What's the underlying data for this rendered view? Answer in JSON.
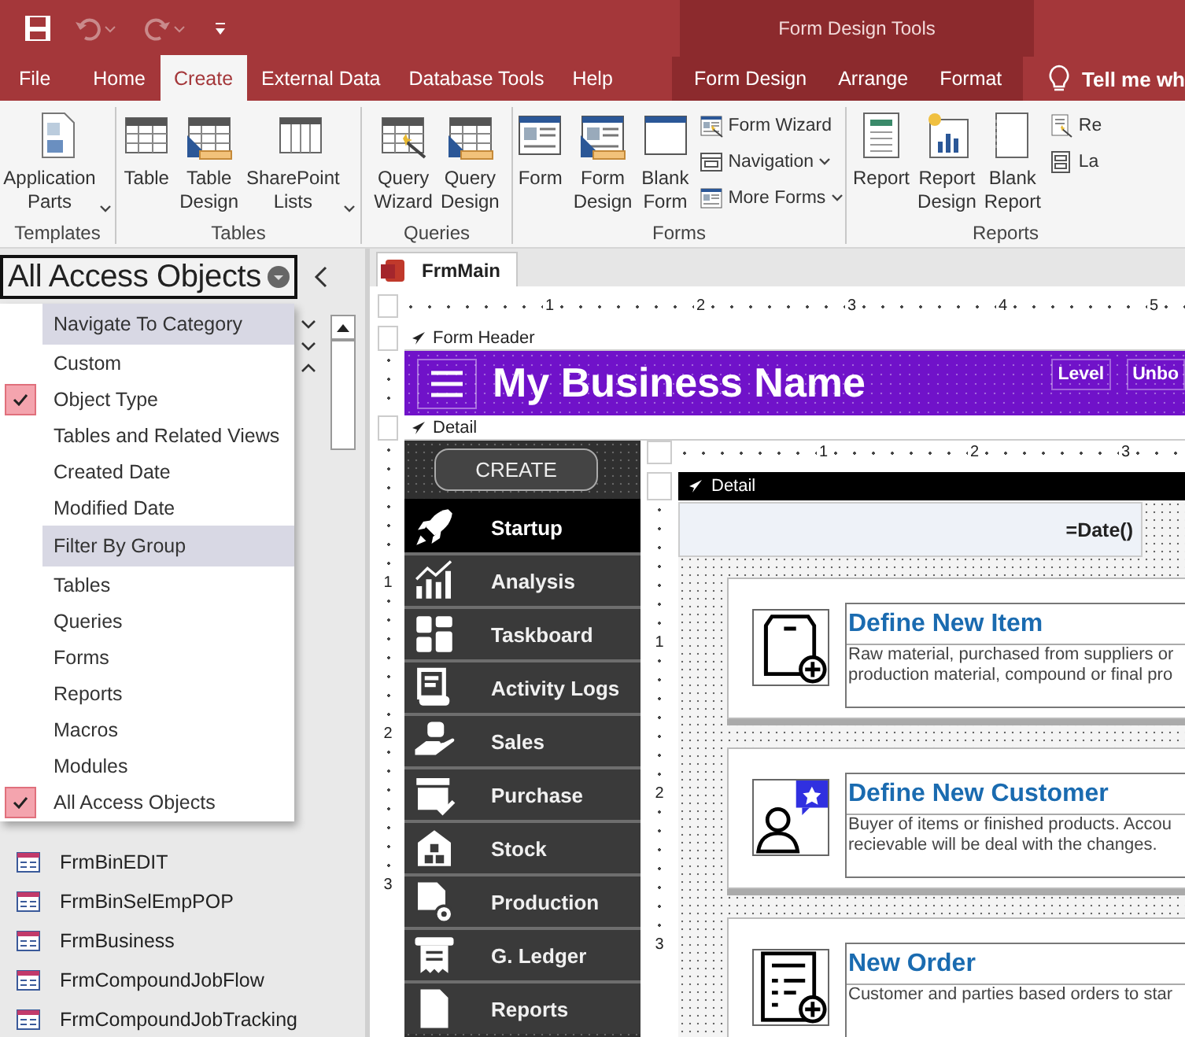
{
  "title_bar": {
    "contextual_title": "Form Design Tools"
  },
  "ribbon_tabs": [
    {
      "label": "File",
      "selected": false,
      "contextual": false
    },
    {
      "label": "Home",
      "selected": false,
      "contextual": false
    },
    {
      "label": "Create",
      "selected": true,
      "contextual": false
    },
    {
      "label": "External Data",
      "selected": false,
      "contextual": false
    },
    {
      "label": "Database Tools",
      "selected": false,
      "contextual": false
    },
    {
      "label": "Help",
      "selected": false,
      "contextual": false
    },
    {
      "label": "Form Design",
      "selected": false,
      "contextual": true
    },
    {
      "label": "Arrange",
      "selected": false,
      "contextual": true
    },
    {
      "label": "Format",
      "selected": false,
      "contextual": true
    }
  ],
  "tell_me": "Tell me wh",
  "ribbon_groups": [
    {
      "title": "Templates",
      "buttons": [
        {
          "kind": "large",
          "label": "Application Parts",
          "dropdown": true
        }
      ]
    },
    {
      "title": "Tables",
      "buttons": [
        {
          "kind": "large",
          "label": "Table",
          "dropdown": false
        },
        {
          "kind": "large",
          "label": "Table Design",
          "dropdown": false
        },
        {
          "kind": "large",
          "label": "SharePoint Lists",
          "dropdown": true
        }
      ]
    },
    {
      "title": "Queries",
      "buttons": [
        {
          "kind": "large",
          "label": "Query Wizard",
          "dropdown": false
        },
        {
          "kind": "large",
          "label": "Query Design",
          "dropdown": false
        }
      ]
    },
    {
      "title": "Forms",
      "buttons": [
        {
          "kind": "large",
          "label": "Form",
          "dropdown": false
        },
        {
          "kind": "large",
          "label": "Form Design",
          "dropdown": false
        },
        {
          "kind": "large",
          "label": "Blank Form",
          "dropdown": false
        },
        {
          "kind": "small",
          "label": "Form Wizard",
          "dropdown": false
        },
        {
          "kind": "small",
          "label": "Navigation",
          "dropdown": true
        },
        {
          "kind": "small",
          "label": "More Forms",
          "dropdown": true
        }
      ]
    },
    {
      "title": "Reports",
      "buttons": [
        {
          "kind": "large",
          "label": "Report",
          "dropdown": false
        },
        {
          "kind": "large",
          "label": "Report Design",
          "dropdown": false
        },
        {
          "kind": "large",
          "label": "Blank Report",
          "dropdown": false
        },
        {
          "kind": "small",
          "label": "Re",
          "dropdown": false
        },
        {
          "kind": "small",
          "label": "La",
          "dropdown": false
        }
      ]
    }
  ],
  "nav_pane": {
    "title": "All Access Objects",
    "menu": [
      {
        "kind": "heading",
        "label": "Navigate To Category"
      },
      {
        "kind": "option",
        "label": "Custom",
        "checked": false
      },
      {
        "kind": "option",
        "label": "Object Type",
        "checked": true
      },
      {
        "kind": "option",
        "label": "Tables and Related Views",
        "checked": false
      },
      {
        "kind": "option",
        "label": "Created Date",
        "checked": false
      },
      {
        "kind": "option",
        "label": "Modified Date",
        "checked": false
      },
      {
        "kind": "heading",
        "label": "Filter By Group"
      },
      {
        "kind": "option",
        "label": "Tables",
        "checked": false
      },
      {
        "kind": "option",
        "label": "Queries",
        "checked": false
      },
      {
        "kind": "option",
        "label": "Forms",
        "checked": false
      },
      {
        "kind": "option",
        "label": "Reports",
        "checked": false
      },
      {
        "kind": "option",
        "label": "Macros",
        "checked": false
      },
      {
        "kind": "option",
        "label": "Modules",
        "checked": false
      },
      {
        "kind": "option",
        "label": "All Access Objects",
        "checked": true
      }
    ],
    "objects": [
      "FrmBinEDIT",
      "FrmBinSelEmpPOP",
      "FrmBusiness",
      "FrmCompoundJobFlow",
      "FrmCompoundJobTracking"
    ]
  },
  "document_tab": {
    "label": "FrmMain"
  },
  "form": {
    "top_ruler": [
      "1",
      "2",
      "3",
      "4",
      "5"
    ],
    "side_ruler": [
      "1",
      "2",
      "3"
    ],
    "header_section": "Form Header",
    "business_name": "My Business Name",
    "header_labels": [
      "Level",
      "Unbo"
    ],
    "detail_section": "Detail",
    "nav_buttons": [
      {
        "kind": "action",
        "label": "CREATE"
      },
      {
        "kind": "menu",
        "label": "Startup",
        "selected": true
      },
      {
        "kind": "menu",
        "label": "Analysis",
        "selected": false
      },
      {
        "kind": "menu",
        "label": "Taskboard",
        "selected": false
      },
      {
        "kind": "menu",
        "label": "Activity Logs",
        "selected": false
      },
      {
        "kind": "menu",
        "label": "Sales",
        "selected": false
      },
      {
        "kind": "menu",
        "label": "Purchase",
        "selected": false
      },
      {
        "kind": "menu",
        "label": "Stock",
        "selected": false
      },
      {
        "kind": "menu",
        "label": "Production",
        "selected": false
      },
      {
        "kind": "menu",
        "label": "G. Ledger",
        "selected": false
      },
      {
        "kind": "menu",
        "label": "Reports",
        "selected": false
      }
    ]
  },
  "subform": {
    "top_ruler": [
      "1",
      "2",
      "3"
    ],
    "side_ruler": [
      "1",
      "2",
      "3"
    ],
    "section": "Detail",
    "date_field": "=Date()",
    "cards": [
      {
        "title": "Define New Item",
        "lines": [
          "Raw material, purchased from suppliers or",
          "production material, compound or final pro"
        ]
      },
      {
        "title": "Define New Customer",
        "lines": [
          "Buyer of items or finished products. Accou",
          "recievable will be deal with the changes."
        ]
      },
      {
        "title": "New Order",
        "lines": [
          "Customer and parties based orders to star"
        ]
      }
    ]
  }
}
